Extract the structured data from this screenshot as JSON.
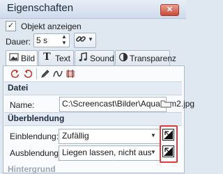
{
  "window": {
    "title": "Eigenschaften",
    "close_symbol": "✕"
  },
  "show_object": {
    "label": "Objekt anzeigen",
    "checked": true,
    "check_symbol": "✓"
  },
  "duration": {
    "label": "Dauer:",
    "value": "5 s",
    "spin_up": "▲",
    "spin_down": "▼"
  },
  "link_menu": {
    "caret": "▼"
  },
  "tabs": [
    {
      "label": "Bild",
      "active": true
    },
    {
      "label": "Text",
      "active": false
    },
    {
      "label": "Sound",
      "active": false
    },
    {
      "label": "Transparenz",
      "active": false
    }
  ],
  "toolbar": {
    "icons": [
      "rotate-left-icon",
      "rotate-right-icon",
      "pencil-icon",
      "wave-icon",
      "crop-icon"
    ]
  },
  "datei": {
    "section_title": "Datei",
    "name_label": "Name:",
    "name_value": "C:\\Screencast\\Bilder\\Aquarium2.jpg"
  },
  "ueberblendung": {
    "section_title": "Überblendung",
    "einblendung_label": "Einblendung:",
    "einblendung_value": "Zufällig",
    "ausblendung_label": "Ausblendung:",
    "ausblendung_value": "Liegen lassen, nicht ausblenden",
    "caret": "▼"
  },
  "hintergrund": {
    "section_title": "Hintergrund"
  },
  "colors": {
    "accent": "#e23a3a",
    "panel": "#fafbfd",
    "section": "#e4ebf4"
  }
}
